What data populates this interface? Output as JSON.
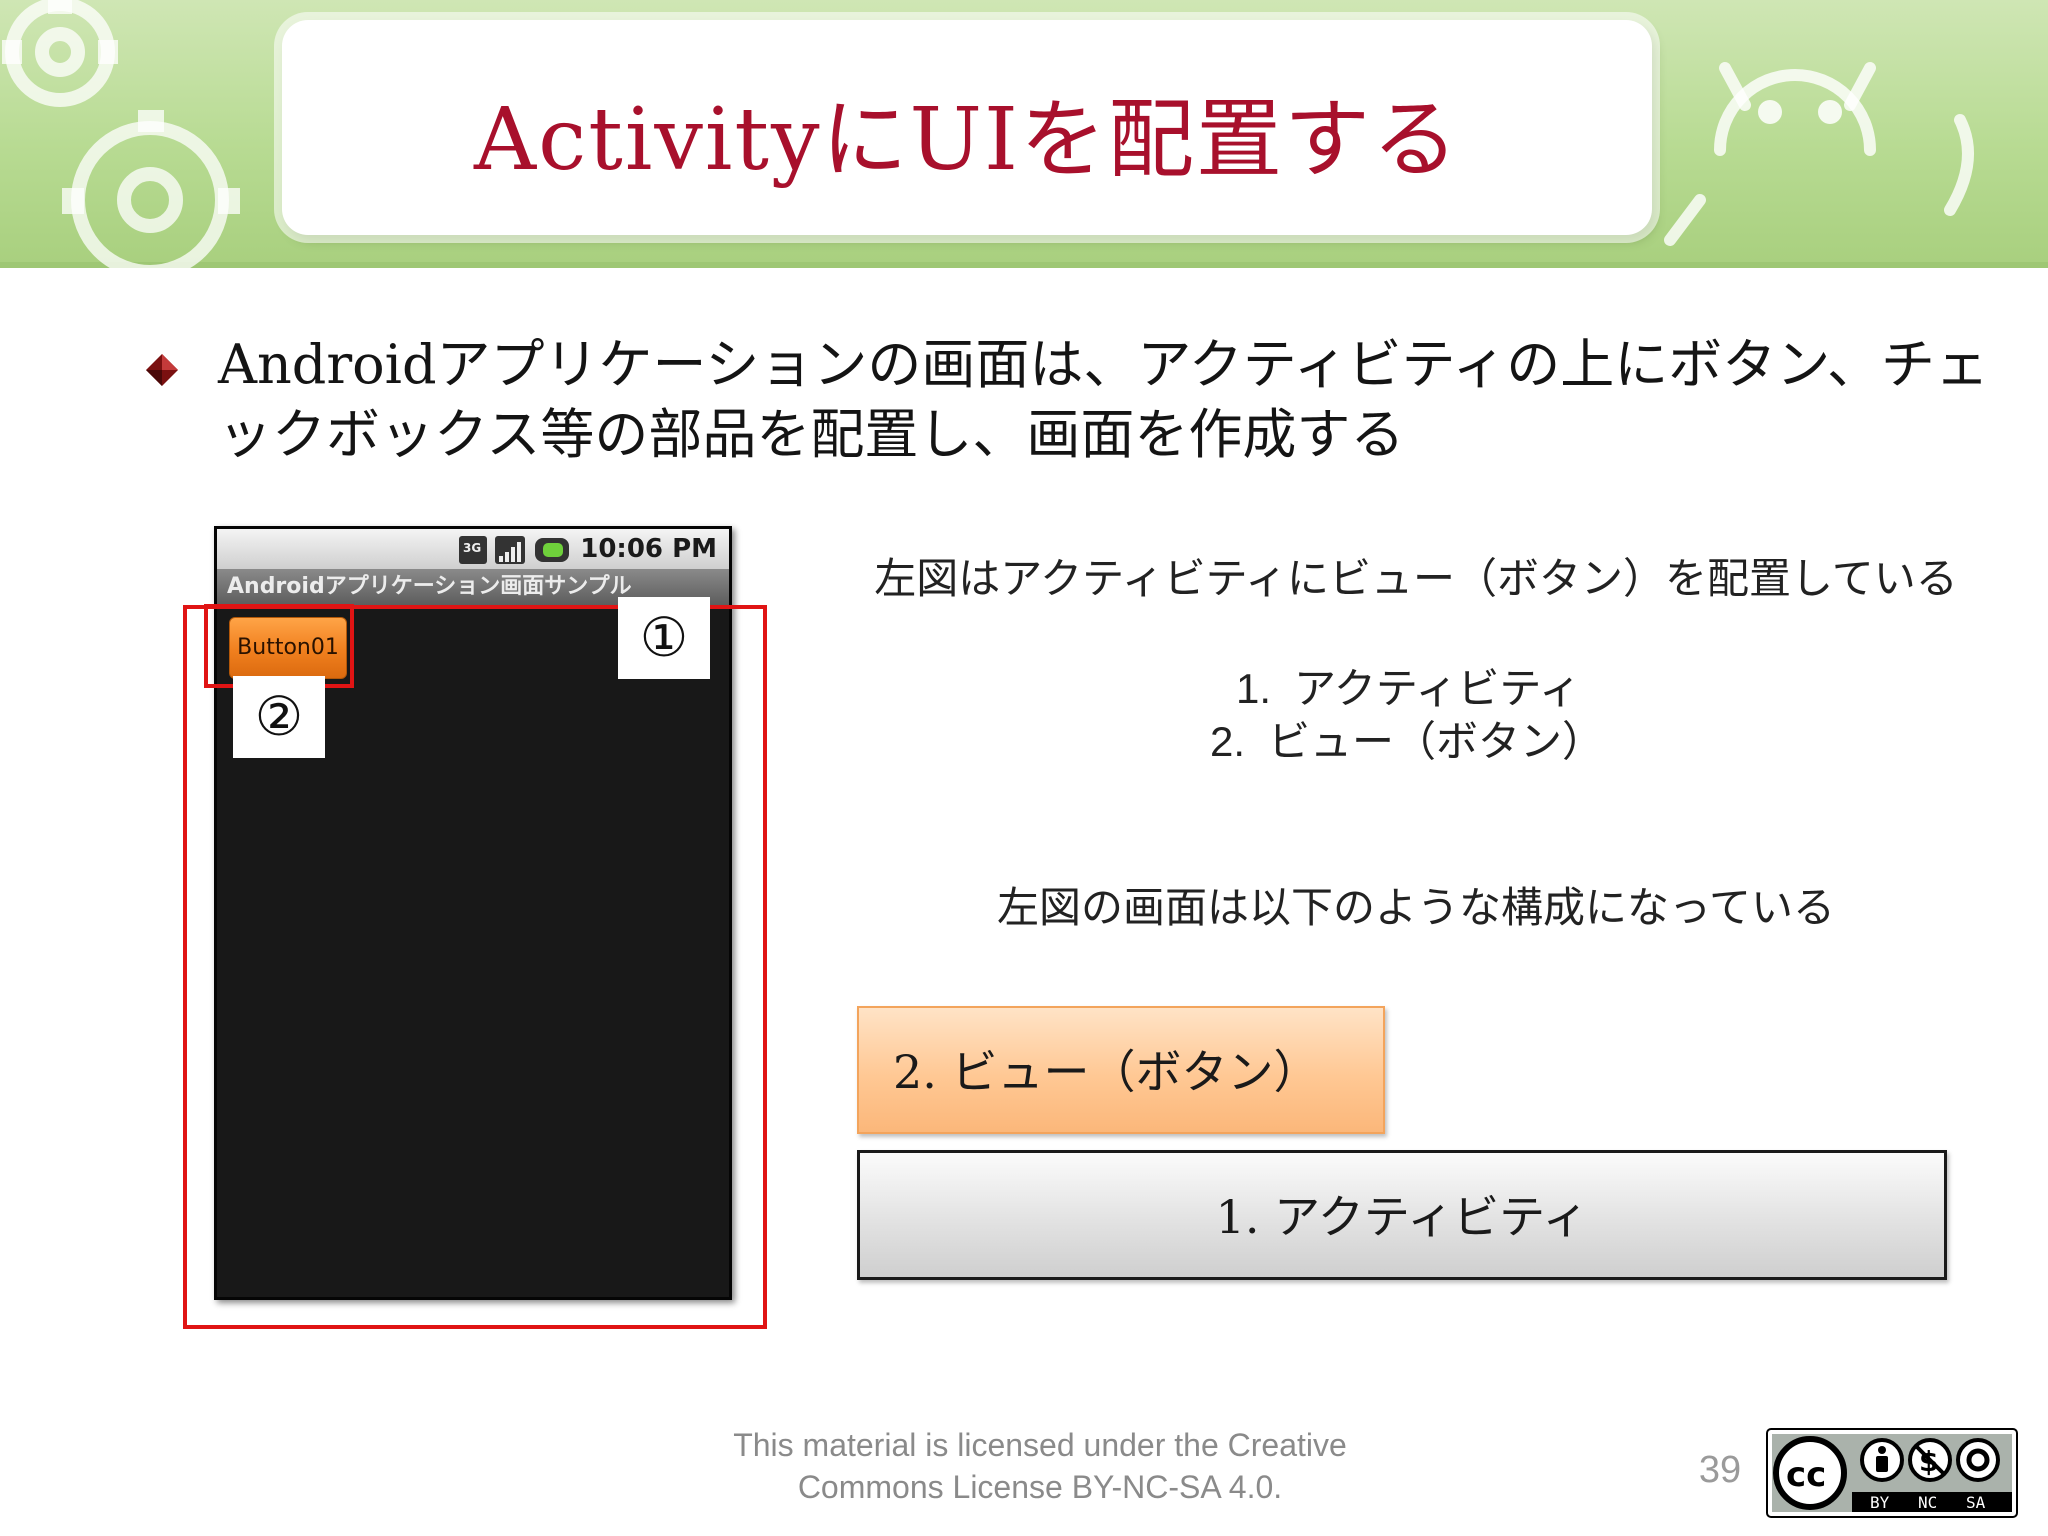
{
  "slide": {
    "title": "ActivityにUIを配置する",
    "bullet": "Androidアプリケーションの画面は、アクティビティの上にボタン、チェックボックス等の部品を配置し、画面を作成する",
    "colors": {
      "title": "#a8102c",
      "banner": "#b8db93",
      "highlight": "#e01414",
      "view_layer": "#ffc894",
      "activity_layer": "#e2e2e2"
    }
  },
  "phone": {
    "status_time": "10:06 PM",
    "status_icons": [
      "3g-icon",
      "signal-icon",
      "battery-icon"
    ],
    "app_title": "Androidアプリケーション画面サンプル",
    "button_label": "Button01"
  },
  "callouts": {
    "activity_num": "①",
    "button_num": "②"
  },
  "caption": {
    "intro": "左図はアクティビティにビュー（ボタン）を配置している",
    "list": [
      {
        "num": "1.",
        "text": "アクティビティ"
      },
      {
        "num": "2.",
        "text": "ビュー（ボタン）"
      }
    ],
    "composition": "左図の画面は以下のような構成になっている"
  },
  "diagram": {
    "view_layer": "2. ビュー（ボタン）",
    "activity_layer": "1. アクティビティ"
  },
  "footer": {
    "license_line1": "This material is licensed under the Creative",
    "license_line2": "Commons License BY-NC-SA 4.0.",
    "page_number": "39",
    "badge_labels": [
      "BY",
      "NC",
      "SA"
    ]
  }
}
